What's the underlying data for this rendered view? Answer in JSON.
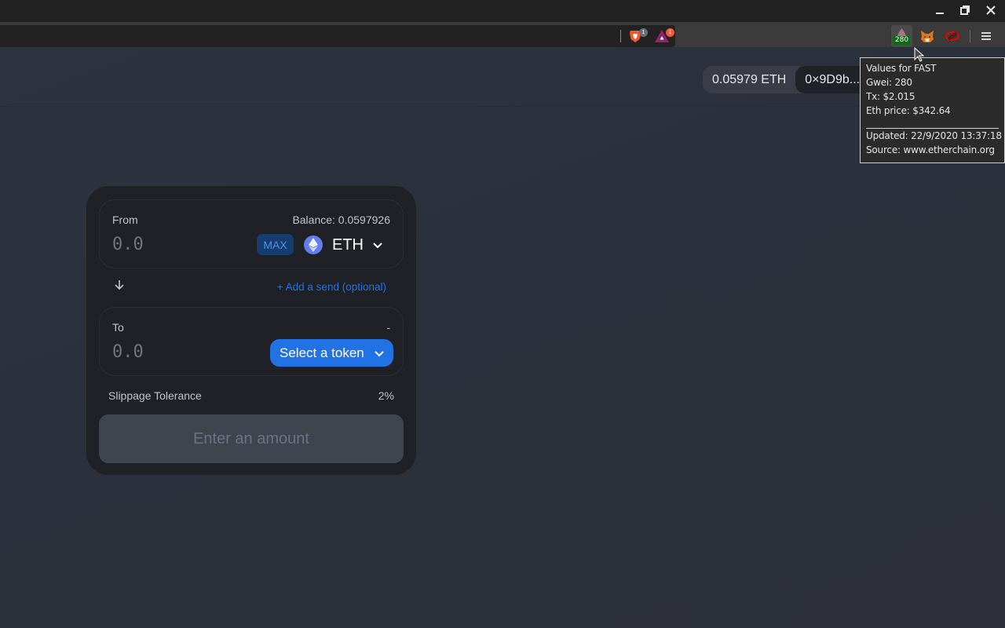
{
  "window": {
    "controls": {
      "minimize": "minimize",
      "restore": "restore",
      "close": "close"
    }
  },
  "toolbar": {
    "brave_shield_badge": "1",
    "bat_rewards_badge": "1",
    "gas_extension_badge": "280",
    "icons": [
      "brave-shield-icon",
      "bat-rewards-icon",
      "gas-price-icon",
      "metamask-fox-icon",
      "zk-extension-icon",
      "menu-icon"
    ]
  },
  "tooltip": {
    "lines": [
      "Values for FAST",
      "Gwei: 280",
      "Tx: $2.015",
      "Eth price: $342.64",
      "______________________________",
      "Updated: 22/9/2020 13:37:18",
      "Source: www.etherchain.org"
    ]
  },
  "account": {
    "balance": "0.05979 ETH",
    "address": "0×9D9b..."
  },
  "swap": {
    "from": {
      "label": "From",
      "balance": "Balance: 0.0597926",
      "amount_placeholder": "0.0",
      "max_label": "MAX",
      "token": "ETH"
    },
    "add_send": "+ Add a send (optional)",
    "to": {
      "label": "To",
      "balance": "-",
      "amount_placeholder": "0.0",
      "select_label": "Select a token"
    },
    "slippage": {
      "label": "Slippage Tolerance",
      "value": "2%"
    },
    "submit_label": "Enter an amount"
  },
  "colors": {
    "accent": "#2172e5",
    "card_bg": "#1f2127",
    "eth_logo": "#627eea",
    "gas_badge": "#0b6b10"
  }
}
